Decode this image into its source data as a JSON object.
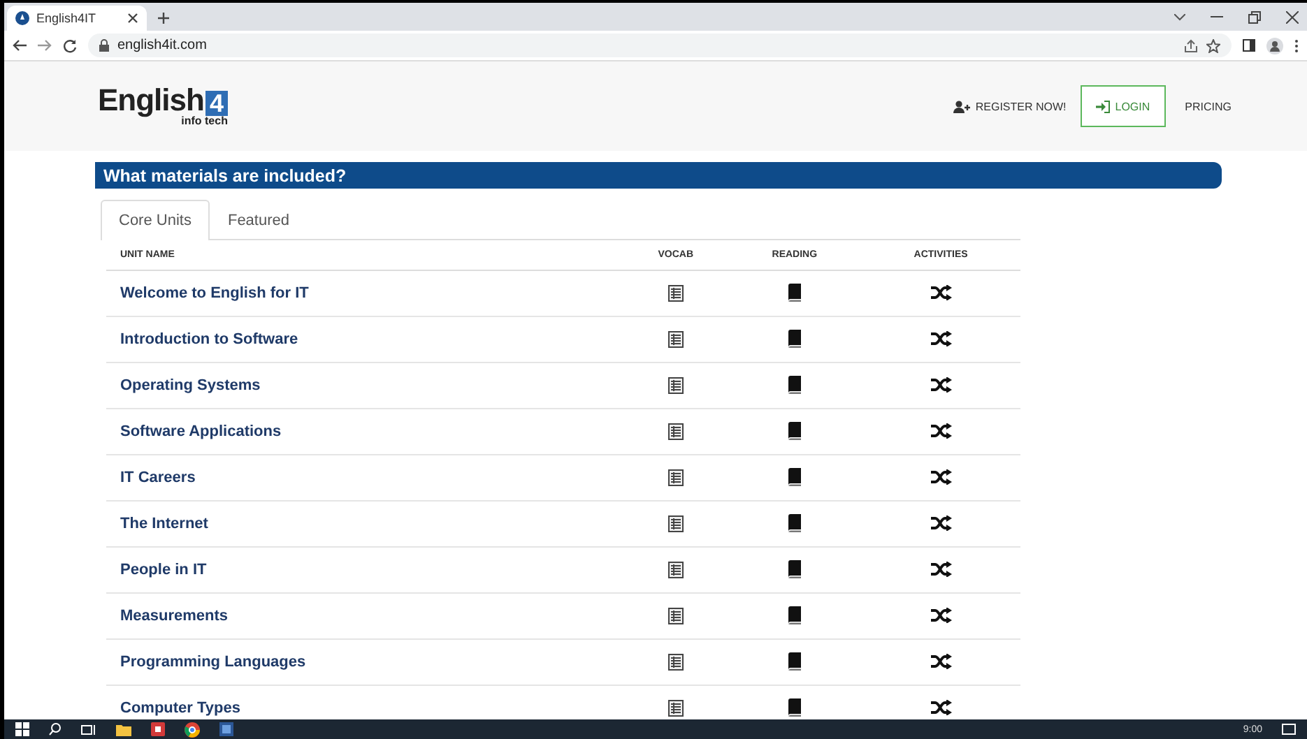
{
  "browser": {
    "tab_title": "English4IT",
    "url": "english4it.com"
  },
  "site_header": {
    "logo_text": "English",
    "logo_mark": "4",
    "logo_tagline": "info tech",
    "nav": [
      {
        "kind": "register",
        "label": "REGISTER NOW!"
      },
      {
        "kind": "login",
        "label": "LOGIN"
      },
      {
        "kind": "link",
        "label": "PRICING"
      }
    ]
  },
  "section_title": "What materials are included?",
  "tabs": [
    {
      "label": "Core Units",
      "selected": true
    },
    {
      "label": "Featured",
      "selected": false
    }
  ],
  "table": {
    "columns": [
      "UNIT NAME",
      "VOCAB",
      "READING",
      "ACTIVITIES"
    ],
    "rows": [
      {
        "unit_name": "Welcome to English for IT"
      },
      {
        "unit_name": "Introduction to Software"
      },
      {
        "unit_name": "Operating Systems"
      },
      {
        "unit_name": "Software Applications"
      },
      {
        "unit_name": "IT Careers"
      },
      {
        "unit_name": "The Internet"
      },
      {
        "unit_name": "People in IT"
      },
      {
        "unit_name": "Measurements"
      },
      {
        "unit_name": "Programming Languages"
      },
      {
        "unit_name": "Computer Types"
      }
    ]
  },
  "taskbar": {
    "clock": "9:00"
  }
}
